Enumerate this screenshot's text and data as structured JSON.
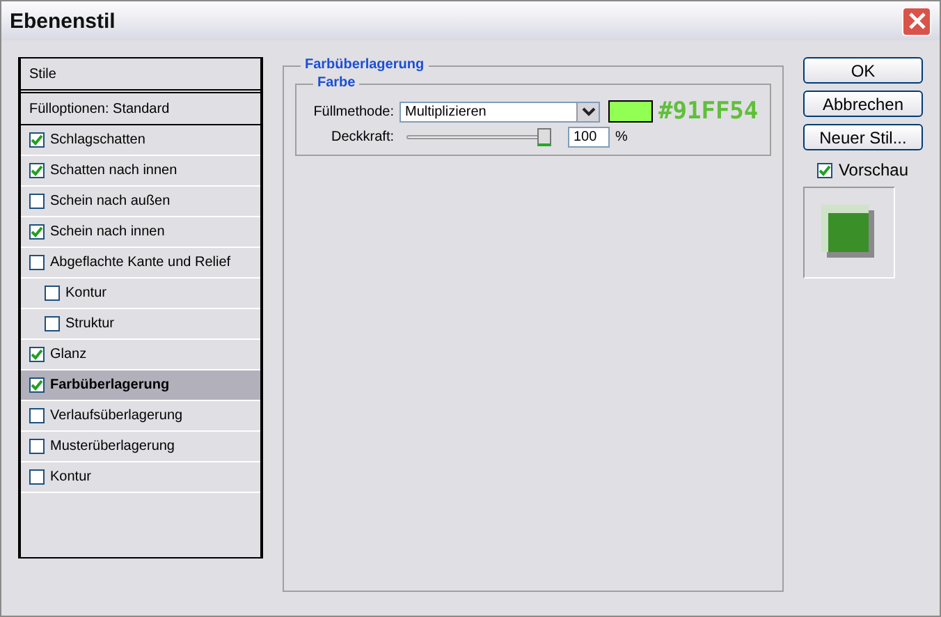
{
  "window": {
    "title": "Ebenenstil"
  },
  "styles": [
    {
      "kind": "header",
      "label": "Stile",
      "selected": false
    },
    {
      "kind": "header",
      "label": "Fülloptionen: Standard",
      "selected": false
    },
    {
      "kind": "check",
      "label": "Schlagschatten",
      "checked": true,
      "selected": false
    },
    {
      "kind": "check",
      "label": "Schatten nach innen",
      "checked": true,
      "selected": false
    },
    {
      "kind": "check",
      "label": "Schein nach außen",
      "checked": false,
      "selected": false
    },
    {
      "kind": "check",
      "label": "Schein nach innen",
      "checked": true,
      "selected": false
    },
    {
      "kind": "check",
      "label": "Abgeflachte Kante und Relief",
      "checked": false,
      "selected": false,
      "children": [
        {
          "label": "Kontur",
          "checked": false
        },
        {
          "label": "Struktur",
          "checked": false
        }
      ]
    },
    {
      "kind": "check",
      "label": "Glanz",
      "checked": true,
      "selected": false
    },
    {
      "kind": "check",
      "label": "Farbüberlagerung",
      "checked": true,
      "selected": true
    },
    {
      "kind": "check",
      "label": "Verlaufsüberlagerung",
      "checked": false,
      "selected": false
    },
    {
      "kind": "check",
      "label": "Musterüberlagerung",
      "checked": false,
      "selected": false
    },
    {
      "kind": "check",
      "label": "Kontur",
      "checked": false,
      "selected": false
    }
  ],
  "panel": {
    "title": "Farbüberlagerung",
    "group": "Farbe",
    "blend_label": "Füllmethode:",
    "blend_value": "Multiplizieren",
    "color": "#91ff54",
    "color_text": "#91FF54",
    "opacity_label": "Deckkraft:",
    "opacity": {
      "level": 1
    },
    "opacity_value": "100",
    "opacity_unit": "%"
  },
  "buttons": [
    "OK",
    "Abbrechen",
    "Neuer Stil..."
  ],
  "preview": {
    "label": "Vorschau",
    "checked": true
  }
}
